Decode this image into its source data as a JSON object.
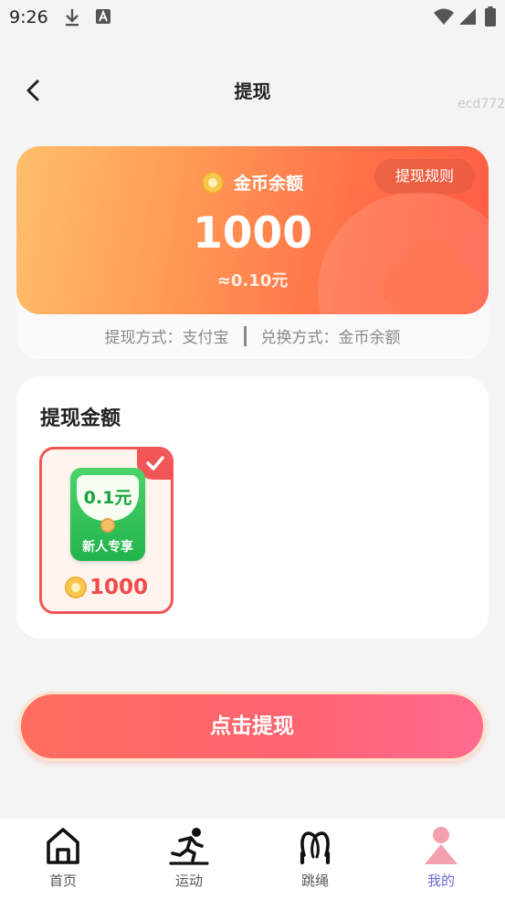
{
  "status_bar": {
    "time": "9:26"
  },
  "header": {
    "title": "提现",
    "user_code": "ecd772"
  },
  "balance": {
    "rules_label": "提现规则",
    "label": "金币余额",
    "amount": "1000",
    "rmb_equivalent": "≈0.10元",
    "method_withdraw": "提现方式：支付宝",
    "method_exchange": "兑换方式：金币余额"
  },
  "amount_section": {
    "title": "提现金额",
    "options": [
      {
        "value": "0.1元",
        "tag": "新人专享",
        "coins": "1000",
        "selected": true
      }
    ]
  },
  "submit": {
    "label": "点击提现"
  },
  "tabs": [
    {
      "label": "首页",
      "icon": "home-icon"
    },
    {
      "label": "运动",
      "icon": "running-icon"
    },
    {
      "label": "跳绳",
      "icon": "jump-rope-icon"
    },
    {
      "label": "我的",
      "icon": "profile-icon",
      "active": true
    }
  ],
  "colors": {
    "accent_red": "#f25555",
    "tab_active": "#6b66d6",
    "envelope_green": "#22b34c"
  }
}
